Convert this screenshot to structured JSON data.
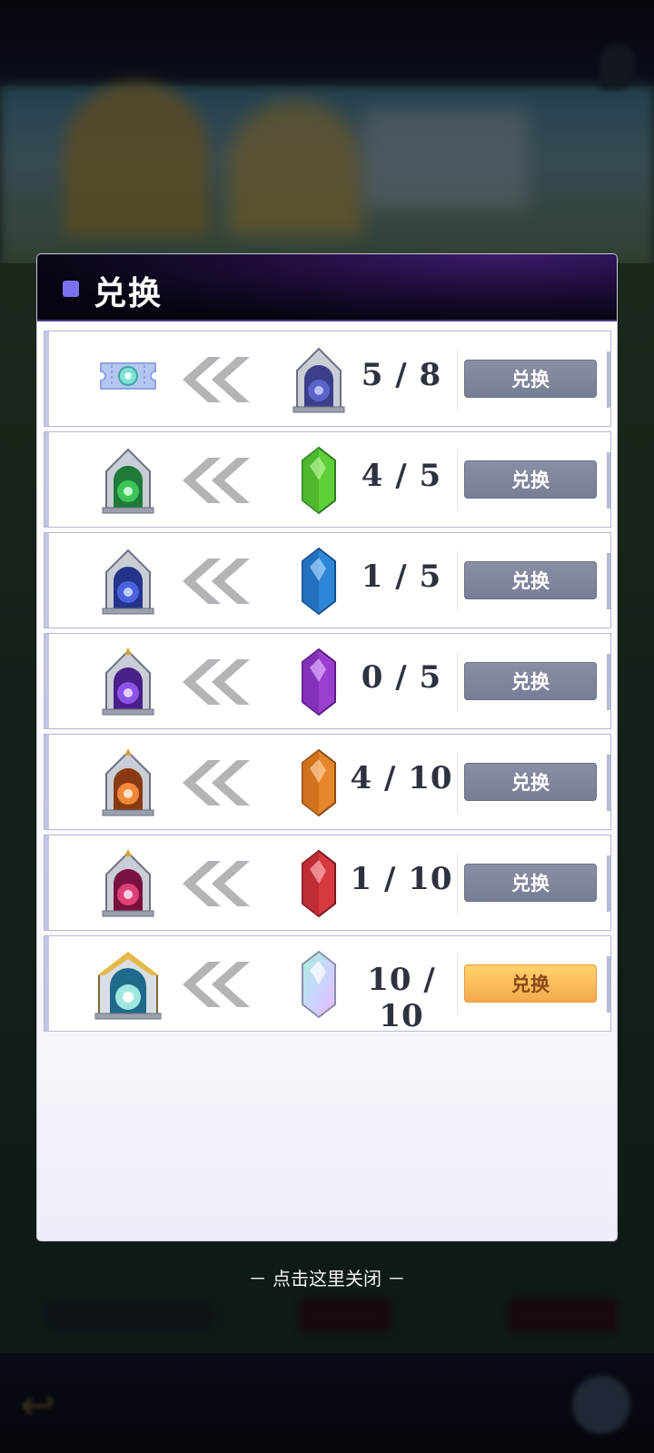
{
  "dialog": {
    "title": "兑换",
    "accent_color": "#7b72f2",
    "close_hint": "－ 点击这里关闭 －"
  },
  "exchange_rows": [
    {
      "source_icon": "ticket-icon",
      "target_icon": "silver-gate-icon",
      "count": "5 / 8",
      "button_label": "兑换",
      "button_state": "disabled",
      "crystal_color": "#3b3f8a"
    },
    {
      "source_icon": "green-gate-icon",
      "target_icon": "green-crystal-icon",
      "count": "4 / 5",
      "button_label": "兑换",
      "button_state": "disabled",
      "crystal_color": "#5fcf3a"
    },
    {
      "source_icon": "blue-gate-icon",
      "target_icon": "blue-crystal-icon",
      "count": "1 / 5",
      "button_label": "兑换",
      "button_state": "disabled",
      "crystal_color": "#2e86d8"
    },
    {
      "source_icon": "purple-gate-icon",
      "target_icon": "purple-crystal-icon",
      "count": "0 / 5",
      "button_label": "兑换",
      "button_state": "disabled",
      "crystal_color": "#9a3fd0"
    },
    {
      "source_icon": "orange-gate-icon",
      "target_icon": "orange-crystal-icon",
      "count": "4 / 10",
      "button_label": "兑换",
      "button_state": "disabled",
      "crystal_color": "#e6862a"
    },
    {
      "source_icon": "red-gate-icon",
      "target_icon": "red-crystal-icon",
      "count": "1 / 10",
      "button_label": "兑换",
      "button_state": "disabled",
      "crystal_color": "#d63a40"
    },
    {
      "source_icon": "golden-gate-icon",
      "target_icon": "rainbow-crystal-icon",
      "count": "10 / 10",
      "button_label": "兑换",
      "button_state": "active",
      "crystal_color": "#9fe8d8"
    }
  ]
}
